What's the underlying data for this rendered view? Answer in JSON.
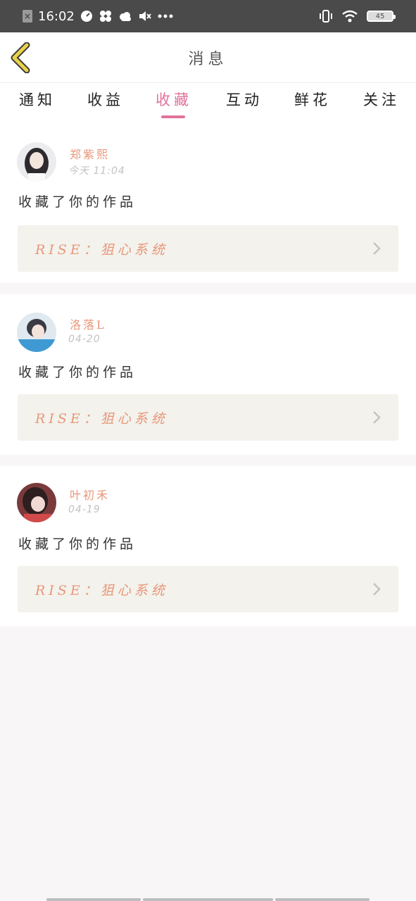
{
  "status_bar": {
    "time": "16:02",
    "battery": "45"
  },
  "header": {
    "title": "消息"
  },
  "tabs": [
    {
      "label": "通知"
    },
    {
      "label": "收益"
    },
    {
      "label": "收藏",
      "active": true
    },
    {
      "label": "互动"
    },
    {
      "label": "鲜花"
    },
    {
      "label": "关注"
    }
  ],
  "items": [
    {
      "user": "郑紫熙",
      "time": "今天 11:04",
      "action": "收藏了你的作品",
      "work": "RISE：狙心系统"
    },
    {
      "user": "洛落L",
      "time": "04-20",
      "action": "收藏了你的作品",
      "work": "RISE：狙心系统"
    },
    {
      "user": "叶初禾",
      "time": "04-19",
      "action": "收藏了你的作品",
      "work": "RISE：狙心系统"
    }
  ],
  "colors": {
    "accent": "#e2729c",
    "username": "#e8977a",
    "back_arrow": "#e9d24a",
    "status_bar": "#4a4a4a"
  }
}
